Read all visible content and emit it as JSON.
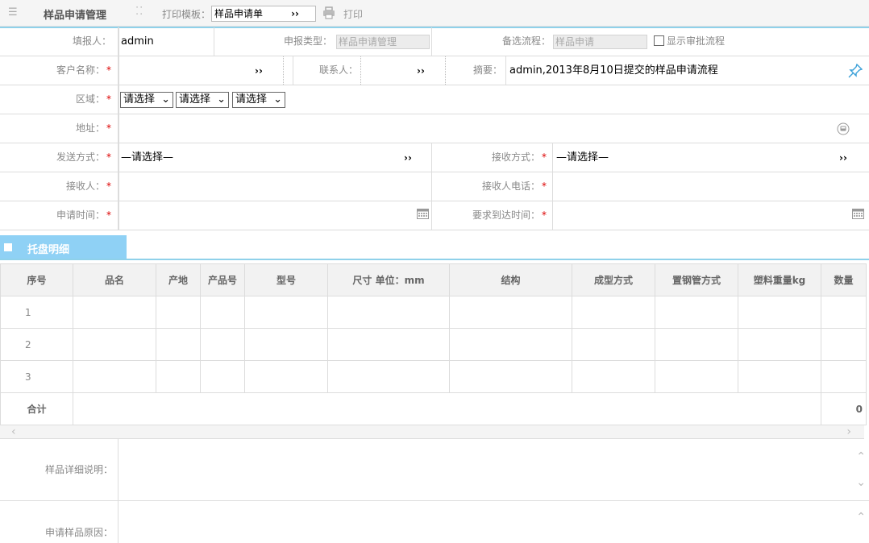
{
  "toolbar": {
    "title": "样品申请管理",
    "print_template_label": "打印模板：",
    "print_template_value": "样品申请单",
    "print_label": "打印"
  },
  "form": {
    "reporter_label": "填报人：",
    "reporter_value": "admin",
    "report_type_label": "申报类型：",
    "report_type_value": "样品申请管理",
    "alt_flow_label": "备选流程：",
    "alt_flow_value": "样品申请",
    "show_approval_label": "显示审批流程",
    "customer_label": "客户名称：",
    "contact_label": "联系人：",
    "summary_label": "摘要：",
    "summary_value": "admin,2013年8月10日提交的样品申请流程",
    "region_label": "区域：",
    "region_selects": [
      "请选择",
      "请选择",
      "请选择"
    ],
    "address_label": "地址：",
    "send_method_label": "发送方式：",
    "send_method_value": "—请选择—",
    "receive_method_label": "接收方式：",
    "receive_method_value": "—请选择—",
    "receiver_label": "接收人：",
    "receiver_phone_label": "接收人电话：",
    "apply_time_label": "申请时间：",
    "arrival_time_label": "要求到达时间：",
    "required_mark": "*",
    "more_marker": "››"
  },
  "section": {
    "title": "托盘明细"
  },
  "grid": {
    "headers": [
      "序号",
      "品名",
      "产地",
      "产品号",
      "型号",
      "尺寸 单位：mm",
      "结构",
      "成型方式",
      "置钢管方式",
      "塑料重量kg",
      "数量"
    ],
    "rows": [
      "1",
      "2",
      "3"
    ],
    "total_label": "合计",
    "total_value": "0"
  },
  "details": {
    "sample_desc_label": "样品详细说明：",
    "apply_reason_label": "申请样品原因："
  },
  "colors": {
    "accent": "#8fd1f5",
    "required": "#d00000"
  }
}
